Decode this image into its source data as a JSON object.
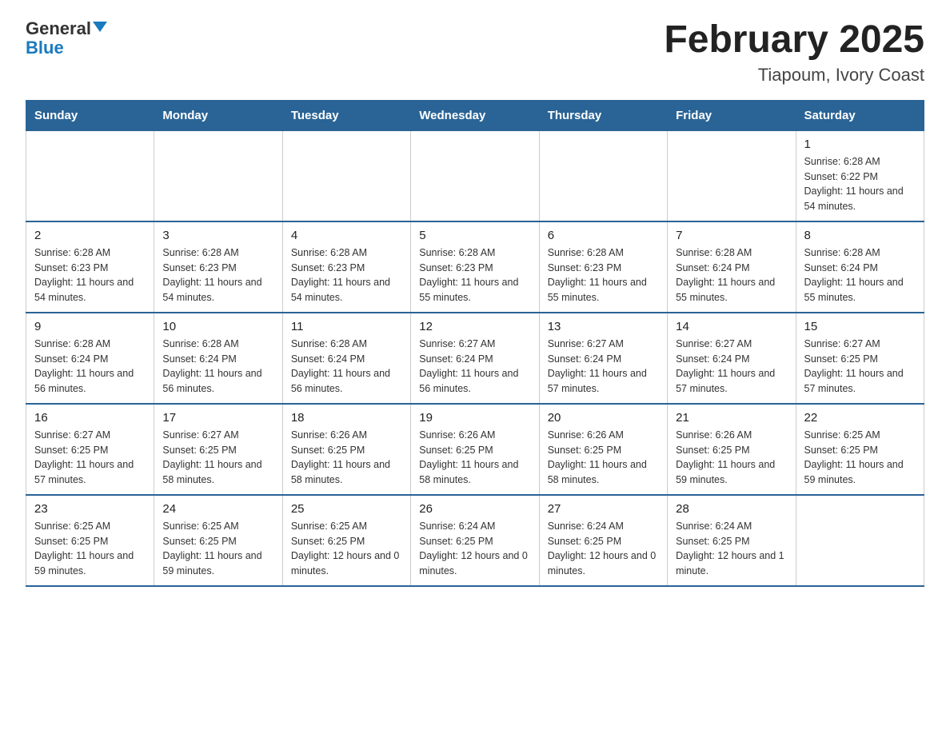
{
  "logo": {
    "text_general": "General",
    "text_blue": "Blue"
  },
  "header": {
    "title": "February 2025",
    "subtitle": "Tiapoum, Ivory Coast"
  },
  "weekdays": [
    "Sunday",
    "Monday",
    "Tuesday",
    "Wednesday",
    "Thursday",
    "Friday",
    "Saturday"
  ],
  "weeks": [
    [
      {
        "day": "",
        "info": ""
      },
      {
        "day": "",
        "info": ""
      },
      {
        "day": "",
        "info": ""
      },
      {
        "day": "",
        "info": ""
      },
      {
        "day": "",
        "info": ""
      },
      {
        "day": "",
        "info": ""
      },
      {
        "day": "1",
        "info": "Sunrise: 6:28 AM\nSunset: 6:22 PM\nDaylight: 11 hours and 54 minutes."
      }
    ],
    [
      {
        "day": "2",
        "info": "Sunrise: 6:28 AM\nSunset: 6:23 PM\nDaylight: 11 hours and 54 minutes."
      },
      {
        "day": "3",
        "info": "Sunrise: 6:28 AM\nSunset: 6:23 PM\nDaylight: 11 hours and 54 minutes."
      },
      {
        "day": "4",
        "info": "Sunrise: 6:28 AM\nSunset: 6:23 PM\nDaylight: 11 hours and 54 minutes."
      },
      {
        "day": "5",
        "info": "Sunrise: 6:28 AM\nSunset: 6:23 PM\nDaylight: 11 hours and 55 minutes."
      },
      {
        "day": "6",
        "info": "Sunrise: 6:28 AM\nSunset: 6:23 PM\nDaylight: 11 hours and 55 minutes."
      },
      {
        "day": "7",
        "info": "Sunrise: 6:28 AM\nSunset: 6:24 PM\nDaylight: 11 hours and 55 minutes."
      },
      {
        "day": "8",
        "info": "Sunrise: 6:28 AM\nSunset: 6:24 PM\nDaylight: 11 hours and 55 minutes."
      }
    ],
    [
      {
        "day": "9",
        "info": "Sunrise: 6:28 AM\nSunset: 6:24 PM\nDaylight: 11 hours and 56 minutes."
      },
      {
        "day": "10",
        "info": "Sunrise: 6:28 AM\nSunset: 6:24 PM\nDaylight: 11 hours and 56 minutes."
      },
      {
        "day": "11",
        "info": "Sunrise: 6:28 AM\nSunset: 6:24 PM\nDaylight: 11 hours and 56 minutes."
      },
      {
        "day": "12",
        "info": "Sunrise: 6:27 AM\nSunset: 6:24 PM\nDaylight: 11 hours and 56 minutes."
      },
      {
        "day": "13",
        "info": "Sunrise: 6:27 AM\nSunset: 6:24 PM\nDaylight: 11 hours and 57 minutes."
      },
      {
        "day": "14",
        "info": "Sunrise: 6:27 AM\nSunset: 6:24 PM\nDaylight: 11 hours and 57 minutes."
      },
      {
        "day": "15",
        "info": "Sunrise: 6:27 AM\nSunset: 6:25 PM\nDaylight: 11 hours and 57 minutes."
      }
    ],
    [
      {
        "day": "16",
        "info": "Sunrise: 6:27 AM\nSunset: 6:25 PM\nDaylight: 11 hours and 57 minutes."
      },
      {
        "day": "17",
        "info": "Sunrise: 6:27 AM\nSunset: 6:25 PM\nDaylight: 11 hours and 58 minutes."
      },
      {
        "day": "18",
        "info": "Sunrise: 6:26 AM\nSunset: 6:25 PM\nDaylight: 11 hours and 58 minutes."
      },
      {
        "day": "19",
        "info": "Sunrise: 6:26 AM\nSunset: 6:25 PM\nDaylight: 11 hours and 58 minutes."
      },
      {
        "day": "20",
        "info": "Sunrise: 6:26 AM\nSunset: 6:25 PM\nDaylight: 11 hours and 58 minutes."
      },
      {
        "day": "21",
        "info": "Sunrise: 6:26 AM\nSunset: 6:25 PM\nDaylight: 11 hours and 59 minutes."
      },
      {
        "day": "22",
        "info": "Sunrise: 6:25 AM\nSunset: 6:25 PM\nDaylight: 11 hours and 59 minutes."
      }
    ],
    [
      {
        "day": "23",
        "info": "Sunrise: 6:25 AM\nSunset: 6:25 PM\nDaylight: 11 hours and 59 minutes."
      },
      {
        "day": "24",
        "info": "Sunrise: 6:25 AM\nSunset: 6:25 PM\nDaylight: 11 hours and 59 minutes."
      },
      {
        "day": "25",
        "info": "Sunrise: 6:25 AM\nSunset: 6:25 PM\nDaylight: 12 hours and 0 minutes."
      },
      {
        "day": "26",
        "info": "Sunrise: 6:24 AM\nSunset: 6:25 PM\nDaylight: 12 hours and 0 minutes."
      },
      {
        "day": "27",
        "info": "Sunrise: 6:24 AM\nSunset: 6:25 PM\nDaylight: 12 hours and 0 minutes."
      },
      {
        "day": "28",
        "info": "Sunrise: 6:24 AM\nSunset: 6:25 PM\nDaylight: 12 hours and 1 minute."
      },
      {
        "day": "",
        "info": ""
      }
    ]
  ]
}
